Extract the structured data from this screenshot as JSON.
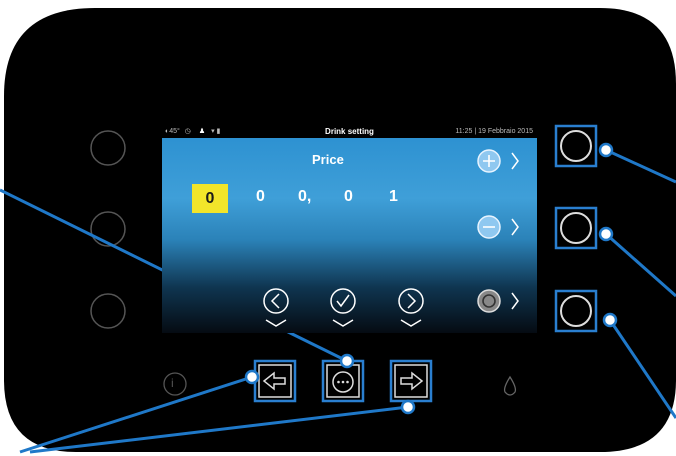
{
  "status_bar": {
    "temperature": "45°",
    "title": "Drink setting",
    "datetime": "11:25 | 19 Febbraio 2015"
  },
  "screen": {
    "price_label": "Price",
    "digits": [
      "0",
      "0",
      "0,",
      "0",
      "1"
    ],
    "selected_digit_index": 0
  },
  "side_symbols": {
    "plus": "+",
    "minus": "−"
  },
  "hw_labels": {
    "info": "i"
  },
  "colors": {
    "panel": "#000000",
    "screen_top": "#3f9fd8",
    "highlight": "#f2e52a",
    "callout": "#1f78c8"
  }
}
